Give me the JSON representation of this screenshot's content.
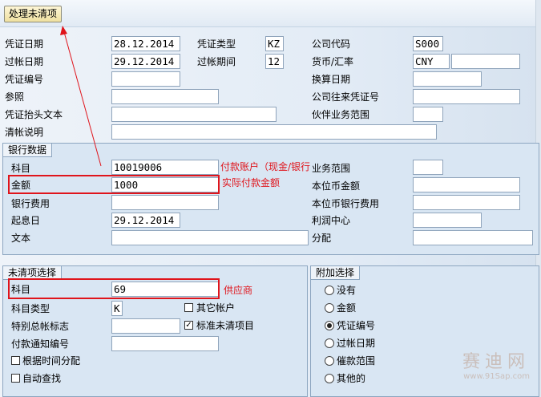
{
  "toolbar": {
    "process_open_items": "处理未清项"
  },
  "header": {
    "doc_date": {
      "label": "凭证日期",
      "value": "28.12.2014"
    },
    "doc_type": {
      "label": "凭证类型",
      "value": "KZ"
    },
    "company_code": {
      "label": "公司代码",
      "value": "S000"
    },
    "posting_date": {
      "label": "过帐日期",
      "value": "29.12.2014"
    },
    "posting_period": {
      "label": "过帐期间",
      "value": "12"
    },
    "currency": {
      "label": "货币/汇率",
      "value": "CNY",
      "rate": ""
    },
    "doc_number": {
      "label": "凭证编号",
      "value": ""
    },
    "translation_date": {
      "label": "换算日期",
      "value": ""
    },
    "reference": {
      "label": "参照",
      "value": ""
    },
    "intercompany_doc": {
      "label": "公司往来凭证号",
      "value": ""
    },
    "header_text": {
      "label": "凭证抬头文本",
      "value": ""
    },
    "trading_partner": {
      "label": "伙伴业务范围",
      "value": ""
    },
    "clearing_text": {
      "label": "清帐说明",
      "value": ""
    }
  },
  "bank_data": {
    "title": "银行数据",
    "account": {
      "label": "科目",
      "value": "10019006",
      "annotation": "付款账户（现金/银行"
    },
    "amount": {
      "label": "金额",
      "value": "1000",
      "annotation": "实际付款金额"
    },
    "bank_charges": {
      "label": "银行费用",
      "value": ""
    },
    "value_date": {
      "label": "起息日",
      "value": "29.12.2014"
    },
    "text": {
      "label": "文本",
      "value": ""
    },
    "business_area": {
      "label": "业务范围",
      "value": ""
    },
    "amount_local": {
      "label": "本位币金额",
      "value": ""
    },
    "bank_charges_local": {
      "label": "本位币银行费用",
      "value": ""
    },
    "profit_center": {
      "label": "利润中心",
      "value": ""
    },
    "assignment": {
      "label": "分配",
      "value": ""
    }
  },
  "open_item_selection": {
    "title": "未清项选择",
    "account": {
      "label": "科目",
      "value": "69",
      "annotation": "供应商"
    },
    "account_type": {
      "label": "科目类型",
      "value": "K"
    },
    "other_accounts": {
      "label": "其它帐户",
      "checked": false
    },
    "special_gl": {
      "label": "特别总帐标志",
      "value": ""
    },
    "standard_oi": {
      "label": "标准未清项目",
      "checked": true
    },
    "payment_advice": {
      "label": "付款通知编号",
      "value": ""
    },
    "distribute_by_age": {
      "label": "根据时间分配",
      "checked": false
    },
    "auto_search": {
      "label": "自动查找",
      "checked": false
    }
  },
  "additional_selection": {
    "title": "附加选择",
    "options": [
      {
        "label": "没有",
        "selected": false
      },
      {
        "label": "金额",
        "selected": false
      },
      {
        "label": "凭证编号",
        "selected": true
      },
      {
        "label": "过帐日期",
        "selected": false
      },
      {
        "label": "催款范围",
        "selected": false
      },
      {
        "label": "其他的",
        "selected": false
      }
    ]
  },
  "watermark": {
    "brand": "赛迪网",
    "url": "www.91Sap.com"
  }
}
